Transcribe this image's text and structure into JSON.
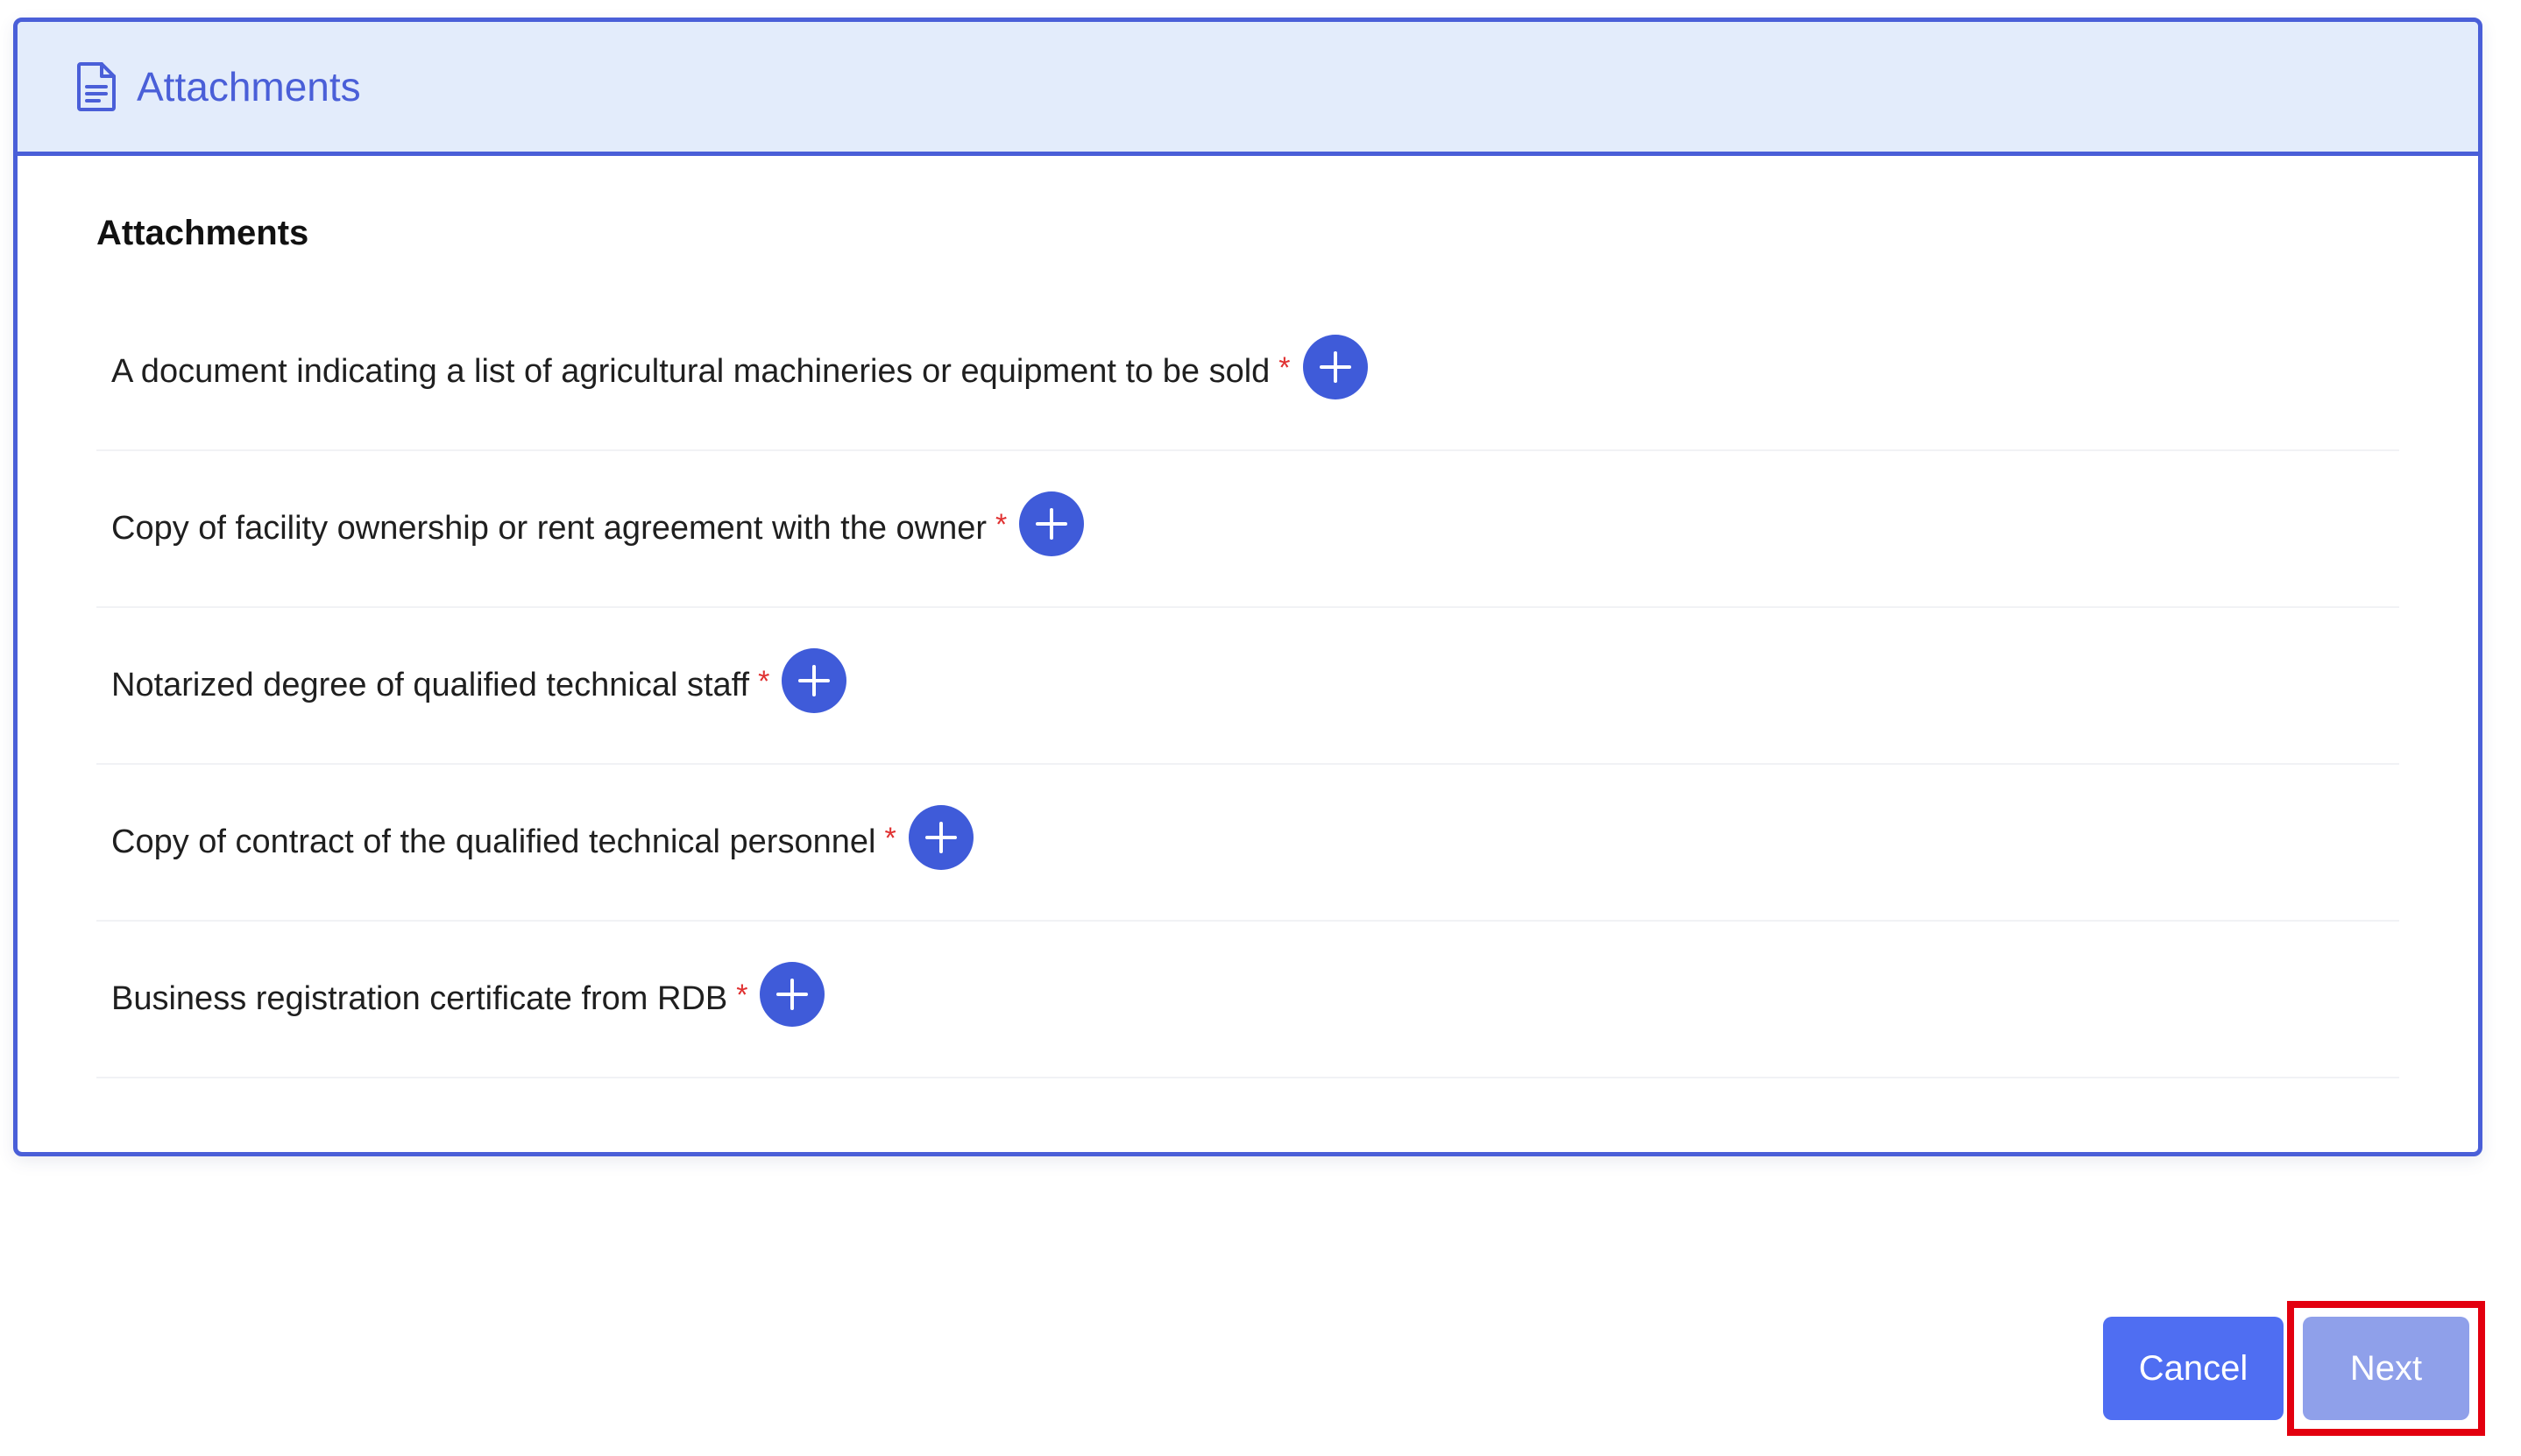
{
  "header": {
    "icon": "document-icon",
    "title": "Attachments"
  },
  "section": {
    "title": "Attachments"
  },
  "attachments": [
    {
      "label": "A document indicating a list of agricultural machineries or equipment to be sold",
      "required_mark": "*",
      "add_icon": "plus-icon"
    },
    {
      "label": "Copy of facility ownership or rent agreement with the owner",
      "required_mark": "*",
      "add_icon": "plus-icon"
    },
    {
      "label": "Notarized degree of qualified technical staff",
      "required_mark": "*",
      "add_icon": "plus-icon"
    },
    {
      "label": "Copy of contract of the qualified technical personnel",
      "required_mark": "*",
      "add_icon": "plus-icon"
    },
    {
      "label": "Business registration certificate from RDB",
      "required_mark": "*",
      "add_icon": "plus-icon"
    }
  ],
  "actions": {
    "cancel_label": "Cancel",
    "next_label": "Next"
  },
  "colors": {
    "accent": "#4a5fd8",
    "header_bg": "#e3ecfb",
    "add_button": "#3f5bd9",
    "required": "#e03131",
    "cancel_button": "#4f6ef2",
    "next_button": "#8fa0ea",
    "highlight": "#e3000f"
  }
}
